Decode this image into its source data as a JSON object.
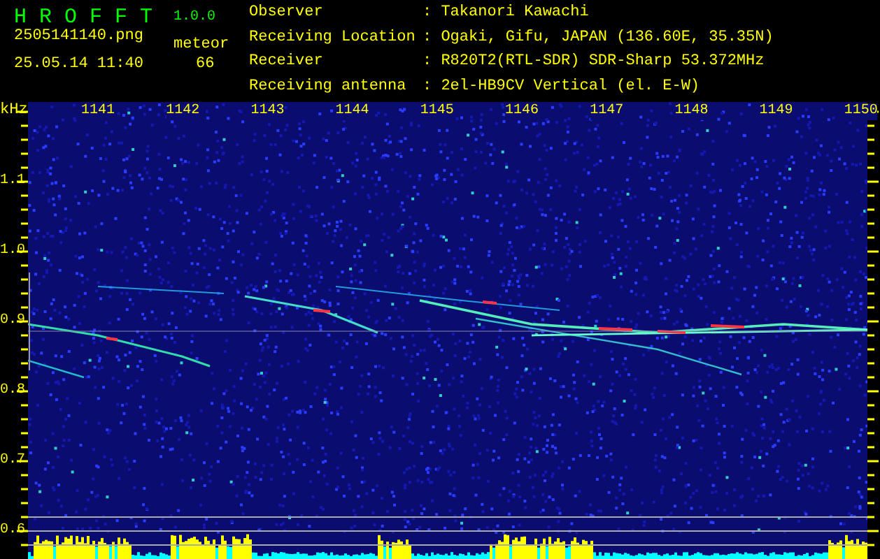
{
  "header": {
    "app_name": "H R O F F T",
    "version": "1.0.0",
    "filename": "2505141140.png",
    "timestamp": "25.05.14 11:40",
    "counter_label": "meteor",
    "counter_value": "66"
  },
  "station_info": [
    {
      "label": "Observer",
      "value": ": Takanori Kawachi"
    },
    {
      "label": "Receiving Location",
      "value": ": Ogaki, Gifu, JAPAN (136.60E, 35.35N)"
    },
    {
      "label": "Receiver",
      "value": ": R820T2(RTL-SDR) SDR-Sharp 53.372MHz"
    },
    {
      "label": "Receiving antenna",
      "value": ": 2el-HB9CV Vertical (el. E-W)"
    }
  ],
  "spectrogram": {
    "unit": "kHz",
    "x_labels": [
      "1141",
      "1142",
      "1143",
      "1144",
      "1145",
      "1146",
      "1147",
      "1148",
      "1149",
      "1150"
    ],
    "y_labels": [
      "1.1",
      "1.0",
      "0.9",
      "0.8",
      "0.7",
      "0.6"
    ]
  }
}
